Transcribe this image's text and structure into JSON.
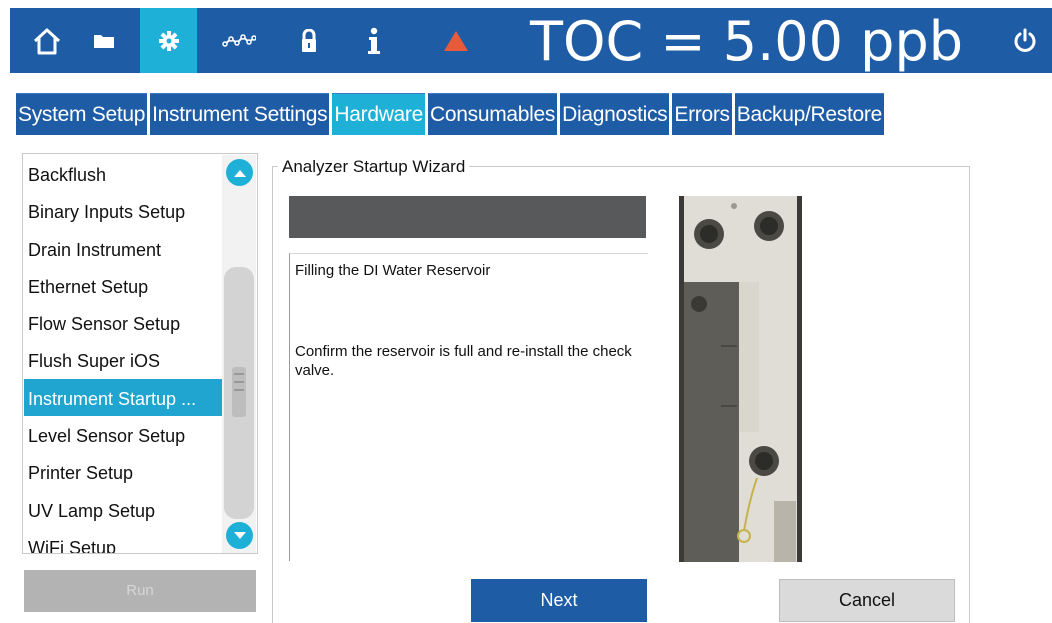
{
  "header": {
    "icons": [
      "home-icon",
      "folder-icon",
      "gear-icon",
      "trend-icon",
      "lock-icon",
      "info-icon",
      "alarm-triangle-icon"
    ],
    "active_icon": "gear-icon",
    "toc_label": "TOC = 5.00 ppb",
    "power_icon": "power-icon",
    "alarm_color": "#e85b3a"
  },
  "tabs": [
    {
      "label": "System Setup"
    },
    {
      "label": "Instrument Settings"
    },
    {
      "label": "Hardware",
      "active": true
    },
    {
      "label": "Consumables"
    },
    {
      "label": "Diagnostics"
    },
    {
      "label": "Errors"
    },
    {
      "label": "Backup/Restore"
    }
  ],
  "sidebar": {
    "items": [
      {
        "label": "Backflush"
      },
      {
        "label": "Binary Inputs Setup"
      },
      {
        "label": "Drain Instrument"
      },
      {
        "label": "Ethernet Setup"
      },
      {
        "label": "Flow Sensor Setup"
      },
      {
        "label": "Flush Super iOS"
      },
      {
        "label": "Instrument Startup ...",
        "selected": true
      },
      {
        "label": "Level Sensor Setup"
      },
      {
        "label": "Printer Setup"
      },
      {
        "label": "UV Lamp Setup"
      },
      {
        "label": "WiFi Setup"
      }
    ],
    "run_label": "Run"
  },
  "wizard": {
    "title": "Analyzer Startup Wizard",
    "step_title": "Filling the DI Water Reservoir",
    "instruction": "Confirm the reservoir is full and re-install the check valve.",
    "next_label": "Next",
    "cancel_label": "Cancel"
  },
  "colors": {
    "primary": "#1f5ca6",
    "accent": "#1fb0d8"
  }
}
